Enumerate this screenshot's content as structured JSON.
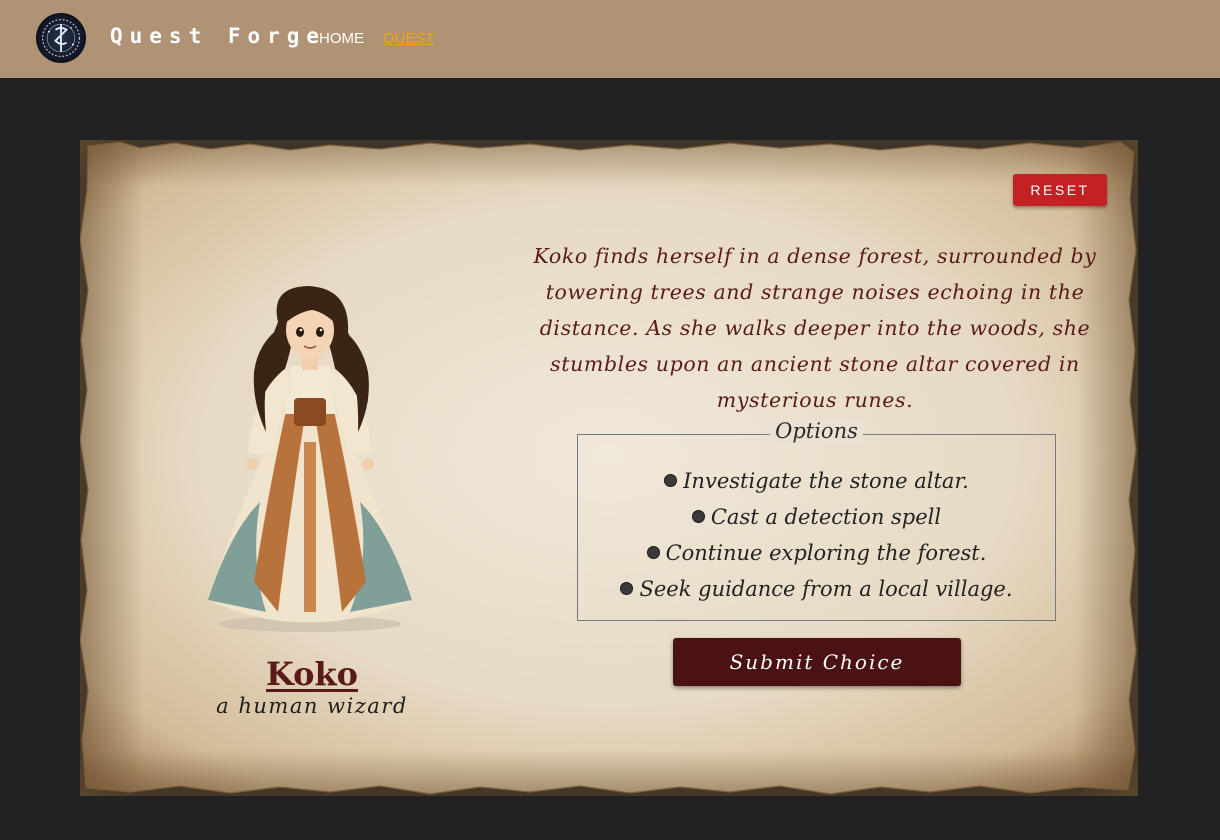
{
  "nav": {
    "brand": "Quest Forge",
    "links": [
      {
        "label": "HOME",
        "active": false
      },
      {
        "label": "QUEST",
        "active": true
      }
    ],
    "active_color": "#f2a413",
    "bar_color": "#b09374"
  },
  "quest": {
    "reset_label": "RESET",
    "character": {
      "name": "Koko",
      "description": "a human wizard"
    },
    "story": "Koko finds herself in a dense forest, surrounded by towering trees and strange noises echoing in the distance. As she walks deeper into the woods, she stumbles upon an ancient stone altar covered in mysterious runes.",
    "options_title": "Options",
    "options": [
      {
        "label": "Investigate the stone altar."
      },
      {
        "label": "Cast a detection spell"
      },
      {
        "label": "Continue exploring the forest."
      },
      {
        "label": "Seek guidance from a local village."
      }
    ],
    "submit_label": "Submit Choice"
  },
  "colors": {
    "background": "#222222",
    "parchment": "#e6d9c4",
    "reset_button": "#c42222",
    "submit_button": "#4a1212",
    "story_text": "#5a1a1a"
  }
}
